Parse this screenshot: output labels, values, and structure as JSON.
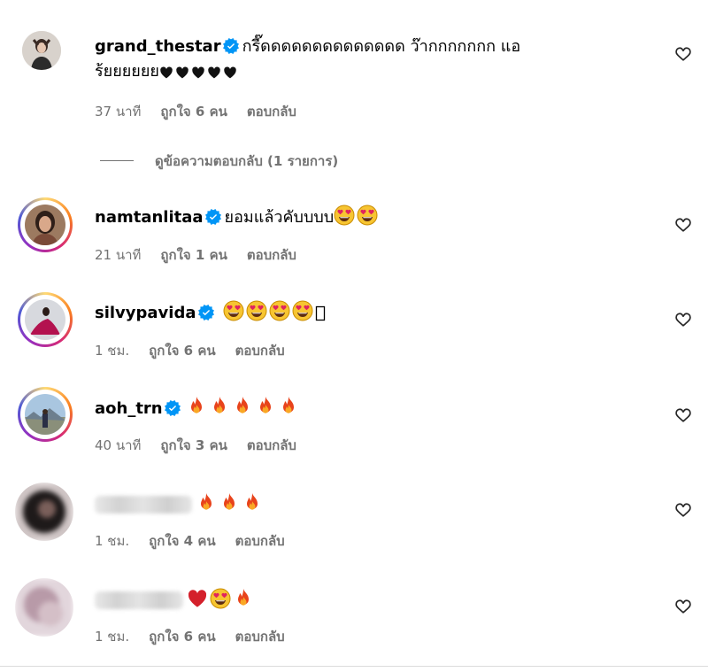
{
  "comments": [
    {
      "username": "grand_thestar",
      "text_line1": "กรี๊ดดดดดดดดดดดดดด ว๊ากกกกกกก แอ",
      "text_line2": "ร้ยยยยยย",
      "time": "37 นาที",
      "likes": "ถูกใจ 6 คน",
      "reply": "ตอบกลับ",
      "emoji": [
        "black-heart",
        "black-heart",
        "black-heart",
        "black-heart",
        "black-heart"
      ]
    },
    {
      "username": "namtanlitaa",
      "text": "ยอมแล้วคับบบบ",
      "time": "21 นาที",
      "likes": "ถูกใจ 1 คน",
      "reply": "ตอบกลับ",
      "emoji": [
        "heart-eyes",
        "heart-eyes"
      ]
    },
    {
      "username": "silvypavida",
      "text": "",
      "time": "1 ชม.",
      "likes": "ถูกใจ 6 คน",
      "reply": "ตอบกลับ",
      "emoji": [
        "heart-eyes",
        "heart-eyes",
        "heart-eyes",
        "heart-eyes",
        "missing-glyph"
      ]
    },
    {
      "username": "aoh_trn",
      "text": "",
      "time": "40 นาที",
      "likes": "ถูกใจ 3 คน",
      "reply": "ตอบกลับ",
      "emoji": [
        "fire",
        "fire",
        "fire",
        "fire",
        "fire"
      ]
    },
    {
      "username": "",
      "text": "",
      "time": "1 ชม.",
      "likes": "ถูกใจ 4 คน",
      "reply": "ตอบกลับ",
      "emoji": [
        "fire",
        "fire",
        "fire"
      ]
    },
    {
      "username": "",
      "text": "",
      "time": "1 ชม.",
      "likes": "ถูกใจ 6 คน",
      "reply": "ตอบกลับ",
      "emoji": [
        "red-heart",
        "heart-eyes",
        "fire"
      ]
    }
  ],
  "view_replies": "ดูข้อความตอบกลับ (1 รายการ)",
  "colors": {
    "meta": "#737373",
    "verified": "#0095f6",
    "divider": "#dbdbdb"
  }
}
